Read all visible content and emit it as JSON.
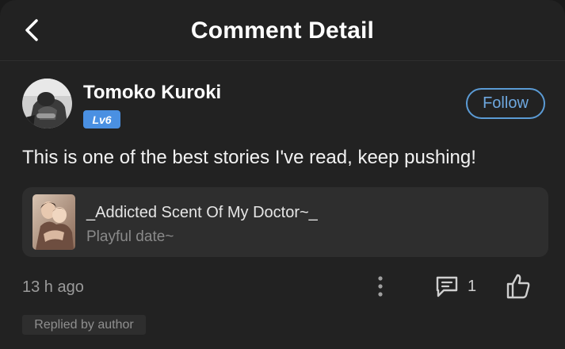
{
  "header": {
    "title": "Comment Detail",
    "back_icon": "chevron-left-icon"
  },
  "comment": {
    "user": {
      "name": "Tomoko Kuroki",
      "level": "Lv6",
      "avatar": "avatar-photo"
    },
    "follow_label": "Follow",
    "text": "This is one of the best stories I've read, keep pushing!",
    "book": {
      "title": "_Addicted Scent Of My Doctor~_",
      "subtitle": "Playful date~",
      "cover": "book-cover-image"
    },
    "time": "13 h ago",
    "reply_count": "1",
    "replied_tag": "Replied by author"
  },
  "colors": {
    "background": "#222222",
    "accent": "#5b9bd5",
    "level_badge": "#4a90e2",
    "card": "#2e2e2e",
    "muted_text": "#9a9a9a"
  }
}
